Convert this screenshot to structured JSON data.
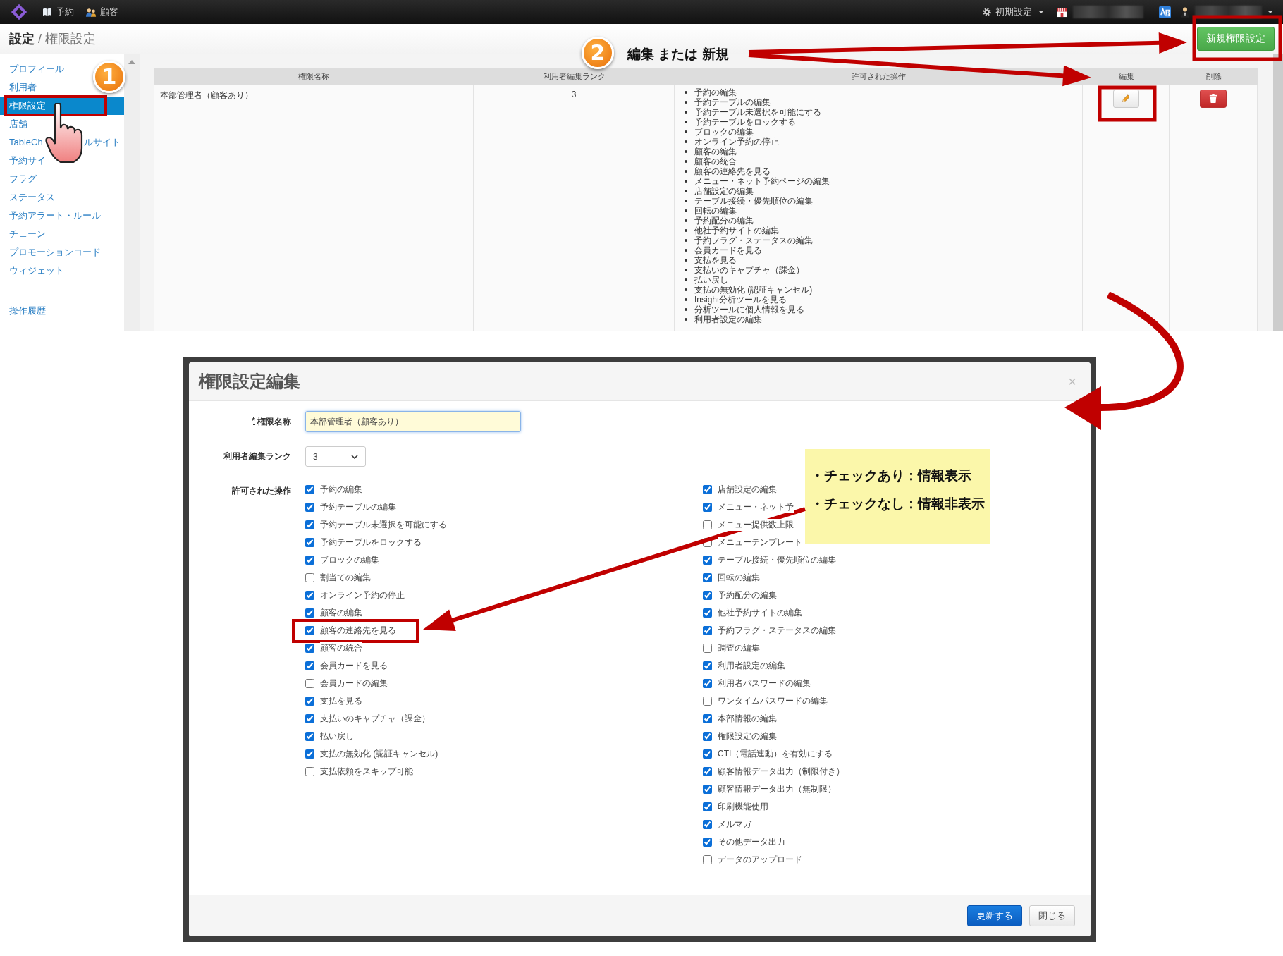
{
  "nav": {
    "items": [
      {
        "label": "予約"
      },
      {
        "label": "顧客"
      }
    ],
    "settings_menu": "初期設定"
  },
  "header": {
    "section": "設定",
    "separator": "/",
    "page": "権限設定",
    "new_button": "新規権限設定"
  },
  "sidebar": {
    "items": [
      {
        "label": "プロフィール",
        "selected": false
      },
      {
        "label": "利用者",
        "selected": false
      },
      {
        "label": "権限設定",
        "selected": true
      },
      {
        "label": "店舗",
        "selected": false
      },
      {
        "label": "TableCh",
        "tail": "ルサイト",
        "selected": false
      },
      {
        "label": "予約サイ",
        "selected": false
      },
      {
        "label": "フラグ",
        "selected": false
      },
      {
        "label": "ステータス",
        "selected": false
      },
      {
        "label": "予約アラート・ルール",
        "selected": false
      },
      {
        "label": "チェーン",
        "selected": false
      },
      {
        "label": "プロモーションコード",
        "selected": false
      },
      {
        "label": "ウィジェット",
        "selected": false
      }
    ],
    "history_link": "操作履歴"
  },
  "table": {
    "columns": [
      "権限名称",
      "利用者編集ランク",
      "許可された操作",
      "編集",
      "削除"
    ],
    "rows": [
      {
        "name": "本部管理者（顧客あり）",
        "rank": "3",
        "operations": [
          "予約の編集",
          "予約テーブルの編集",
          "予約テーブル未選択を可能にする",
          "予約テーブルをロックする",
          "ブロックの編集",
          "オンライン予約の停止",
          "顧客の編集",
          "顧客の統合",
          "顧客の連絡先を見る",
          "メニュー・ネット予約ページの編集",
          "店舗設定の編集",
          "テーブル接続・優先順位の編集",
          "回転の編集",
          "予約配分の編集",
          "他社予約サイトの編集",
          "予約フラグ・ステータスの編集",
          "会員カードを見る",
          "支払を見る",
          "支払いのキャプチャ（課金）",
          "払い戻し",
          "支払の無効化 (認証キャンセル)",
          "Insight分析ツールを見る",
          "分析ツールに個人情報を見る",
          "利用者設定の編集"
        ]
      }
    ]
  },
  "dialog": {
    "title": "権限設定編集",
    "close": "×",
    "required_mark": "*",
    "name_label": "権限名称",
    "name_value": "本部管理者（顧客あり）",
    "rank_label": "利用者編集ランク",
    "rank_value": "3",
    "operations_label": "許可された操作",
    "operations_left": [
      {
        "label": "予約の編集",
        "checked": true
      },
      {
        "label": "予約テーブルの編集",
        "checked": true
      },
      {
        "label": "予約テーブル未選択を可能にする",
        "checked": true
      },
      {
        "label": "予約テーブルをロックする",
        "checked": true
      },
      {
        "label": "ブロックの編集",
        "checked": true
      },
      {
        "label": "割当ての編集",
        "checked": false
      },
      {
        "label": "オンライン予約の停止",
        "checked": true
      },
      {
        "label": "顧客の編集",
        "checked": true
      },
      {
        "label": "顧客の連絡先を見る",
        "checked": true
      },
      {
        "label": "顧客の統合",
        "checked": true
      },
      {
        "label": "会員カードを見る",
        "checked": true
      },
      {
        "label": "会員カードの編集",
        "checked": false
      },
      {
        "label": "支払を見る",
        "checked": true
      },
      {
        "label": "支払いのキャプチャ（課金）",
        "checked": true
      },
      {
        "label": "払い戻し",
        "checked": true
      },
      {
        "label": "支払の無効化 (認証キャンセル)",
        "checked": true
      },
      {
        "label": "支払依頼をスキップ可能",
        "checked": false
      }
    ],
    "operations_right": [
      {
        "label": "店舗設定の編集",
        "checked": true
      },
      {
        "label": "メニュー・ネット予",
        "checked": true
      },
      {
        "label": "メニュー提供数上限",
        "checked": false
      },
      {
        "label": "メニューテンプレート",
        "checked": false
      },
      {
        "label": "テーブル接続・優先順位の編集",
        "checked": true
      },
      {
        "label": "回転の編集",
        "checked": true
      },
      {
        "label": "予約配分の編集",
        "checked": true
      },
      {
        "label": "他社予約サイトの編集",
        "checked": true
      },
      {
        "label": "予約フラグ・ステータスの編集",
        "checked": true
      },
      {
        "label": "調査の編集",
        "checked": false
      },
      {
        "label": "利用者設定の編集",
        "checked": true
      },
      {
        "label": "利用者パスワードの編集",
        "checked": true
      },
      {
        "label": "ワンタイムパスワードの編集",
        "checked": false
      },
      {
        "label": "本部情報の編集",
        "checked": true
      },
      {
        "label": "権限設定の編集",
        "checked": true
      },
      {
        "label": "CTI（電話連動）を有効にする",
        "checked": true
      },
      {
        "label": "顧客情報データ出力（制限付き）",
        "checked": true
      },
      {
        "label": "顧客情報データ出力（無制限）",
        "checked": true
      },
      {
        "label": "印刷機能使用",
        "checked": true
      },
      {
        "label": "メルマガ",
        "checked": true
      },
      {
        "label": "その他データ出力",
        "checked": true
      },
      {
        "label": "データのアップロード",
        "checked": false
      }
    ],
    "buttons": [
      {
        "label": "更新する",
        "kind": "primary"
      },
      {
        "label": "閉じる",
        "kind": "default"
      }
    ]
  },
  "annotations": {
    "step_badges": [
      "1",
      "2"
    ],
    "callout": "編集 または 新規",
    "note_lines": [
      "・チェックあり：情報表示",
      "・チェックなし：情報非表示"
    ]
  }
}
